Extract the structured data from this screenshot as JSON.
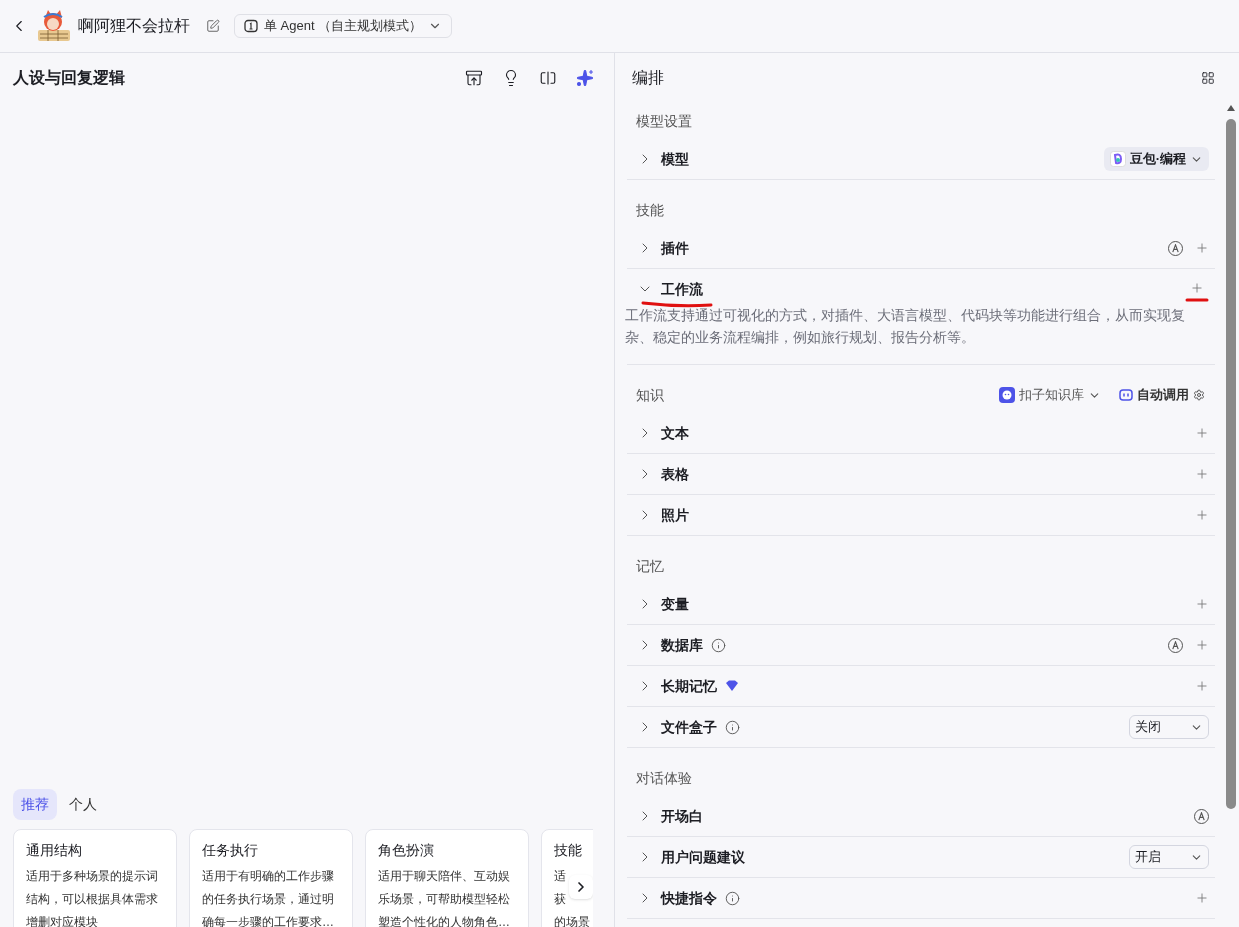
{
  "header": {
    "bot_name": "啊阿狸不会拉杆",
    "mode_label": "单 Agent （自主规划模式）"
  },
  "prompt_panel": {
    "title": "人设与回复逻辑",
    "template_tabs": [
      {
        "label": "推荐",
        "selected": true
      },
      {
        "label": "个人",
        "selected": false
      }
    ],
    "templates": [
      {
        "title": "通用结构",
        "lines": [
          "适用于多种场景的提示词",
          "结构，可以根据具体需求",
          "增删对应模块"
        ]
      },
      {
        "title": "任务执行",
        "lines": [
          "适用于有明确的工作步骤",
          "的任务执行场景，通过明",
          "确每一步骤的工作要求…"
        ]
      },
      {
        "title": "角色扮演",
        "lines": [
          "适用于聊天陪伴、互动娱",
          "乐场景，可帮助模型轻松",
          "塑造个性化的人物角色…"
        ]
      },
      {
        "title": "技能",
        "lines": [
          "适",
          "获",
          "的场景"
        ]
      }
    ]
  },
  "arrange_panel": {
    "title": "编排",
    "sections": [
      {
        "title": "模型设置",
        "items": [
          {
            "label": "模型",
            "expanded": false,
            "model": "豆包·编程"
          }
        ]
      },
      {
        "title": "技能",
        "items": [
          {
            "label": "插件",
            "expanded": false,
            "auto": true,
            "add": true
          },
          {
            "label": "工作流",
            "expanded": true,
            "add": true,
            "marked": true,
            "description": "工作流支持通过可视化的方式，对插件、大语言模型、代码块等功能进行组合，从而实现复杂、稳定的业务流程编排，例如旅行规划、报告分析等。"
          }
        ]
      },
      {
        "title": "知识",
        "source": "扣子知识库",
        "mode": "自动调用",
        "items": [
          {
            "label": "文本",
            "expanded": false,
            "add": true
          },
          {
            "label": "表格",
            "expanded": false,
            "add": true
          },
          {
            "label": "照片",
            "expanded": false,
            "add": true
          }
        ]
      },
      {
        "title": "记忆",
        "items": [
          {
            "label": "变量",
            "expanded": false,
            "add": true
          },
          {
            "label": "数据库",
            "expanded": false,
            "info": true,
            "auto": true,
            "add": true
          },
          {
            "label": "长期记忆",
            "expanded": false,
            "premium": true,
            "add": true
          },
          {
            "label": "文件盒子",
            "expanded": false,
            "info": true,
            "select": "关闭"
          }
        ]
      },
      {
        "title": "对话体验",
        "items": [
          {
            "label": "开场白",
            "expanded": false,
            "auto": true
          },
          {
            "label": "用户问题建议",
            "expanded": false,
            "select": "开启"
          },
          {
            "label": "快捷指令",
            "expanded": false,
            "info": true,
            "add": true
          }
        ]
      }
    ]
  }
}
